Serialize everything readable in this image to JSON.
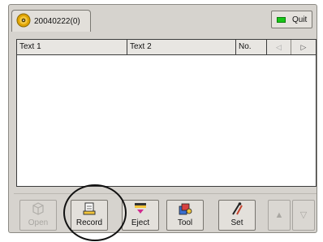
{
  "disc_tab": {
    "label": "20040222(0)",
    "icon": "cd-disc-icon"
  },
  "quit_button": {
    "label": "Quit",
    "indicator_color": "#19c619"
  },
  "list": {
    "columns": [
      {
        "label": "Text 1"
      },
      {
        "label": "Text 2"
      },
      {
        "label": "No."
      }
    ],
    "scroll_left_icon": "triangle-left-icon",
    "scroll_right_icon": "triangle-right-icon",
    "rows": []
  },
  "toolbar": {
    "buttons": [
      {
        "label": "Open",
        "icon": "open-icon",
        "enabled": false
      },
      {
        "label": "Record",
        "icon": "record-icon",
        "enabled": true
      },
      {
        "label": "Eject",
        "icon": "eject-icon",
        "enabled": true
      },
      {
        "label": "Tool",
        "icon": "tool-icon",
        "enabled": true
      },
      {
        "label": "Set",
        "icon": "settings-icon",
        "enabled": true
      }
    ],
    "up_icon": "triangle-up-icon",
    "down_icon": "triangle-down-icon"
  }
}
